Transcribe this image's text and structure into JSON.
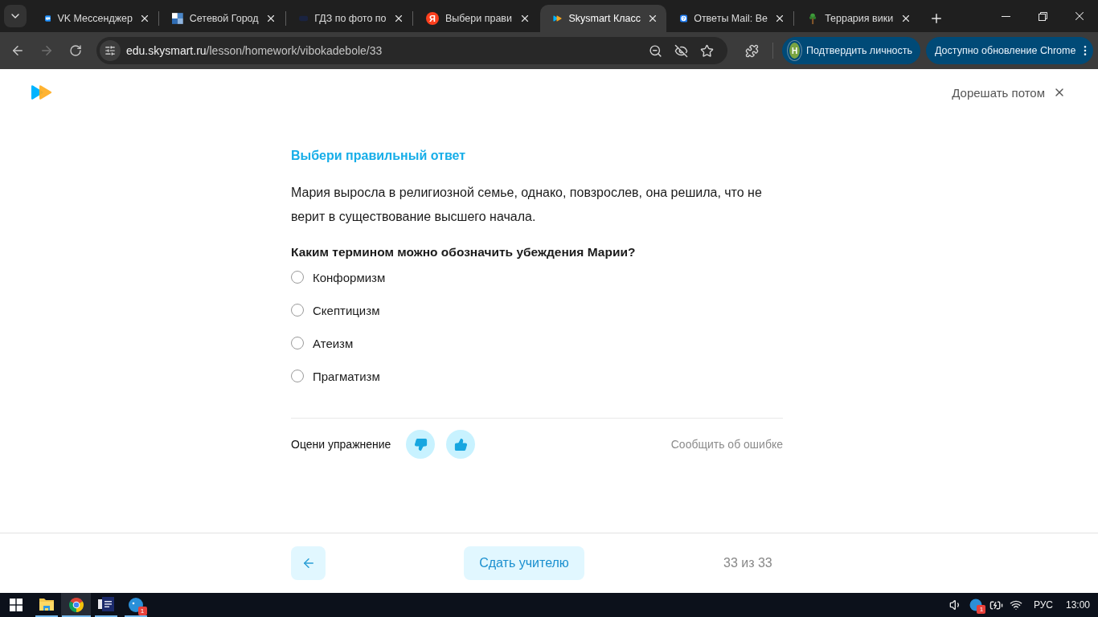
{
  "browser": {
    "tabs": [
      {
        "kind": "chat",
        "title": "VK Мессенджер",
        "selected": false
      },
      {
        "kind": "grid",
        "title": "Сетевой Город",
        "selected": false
      },
      {
        "kind": "dim",
        "title": "ГДЗ по фото по",
        "selected": false
      },
      {
        "kind": "letter",
        "favicon_text": "Я",
        "title": "Выбери прави",
        "selected": false
      },
      {
        "kind": "play",
        "title": "Skysmart Класс",
        "selected": true
      },
      {
        "kind": "question",
        "title": "Ответы Mail: Ве",
        "selected": false
      },
      {
        "kind": "tree",
        "title": "Террария вики",
        "selected": false
      }
    ],
    "address": {
      "host": "edu.skysmart.ru",
      "path": "/lesson/homework/vibokadebole/33"
    },
    "profile": {
      "initial": "Н",
      "label": "Подтвердить личность"
    },
    "update_label": "Доступно обновление Chrome"
  },
  "header": {
    "later": "Дорешать потом"
  },
  "task": {
    "heading": "Выбери правильный ответ",
    "text": "Мария выросла в религиозной семье, однако, повзрослев, она решила, что не верит в существование высшего начала.",
    "question": "Каким термином можно обозначить убеждения Марии?",
    "options": [
      {
        "label": "Конформизм",
        "selected": false
      },
      {
        "label": "Скептицизм",
        "selected": false
      },
      {
        "label": "Атеизм",
        "selected": false
      },
      {
        "label": "Прагматизм",
        "selected": false
      }
    ]
  },
  "rating": {
    "label": "Оцени упражнение",
    "report": "Сообщить об ошибке"
  },
  "footer": {
    "submit": "Сдать учителю",
    "progress": "33 из 33"
  },
  "taskbar": {
    "apps": [
      {
        "kind": "folder",
        "active": false
      },
      {
        "kind": "browser",
        "active": true
      },
      {
        "kind": "document",
        "active": false
      },
      {
        "kind": "messenger",
        "active": false,
        "badge": "1"
      }
    ],
    "tray": {
      "badge": "1",
      "language": "РУС",
      "time": "13:00"
    }
  }
}
